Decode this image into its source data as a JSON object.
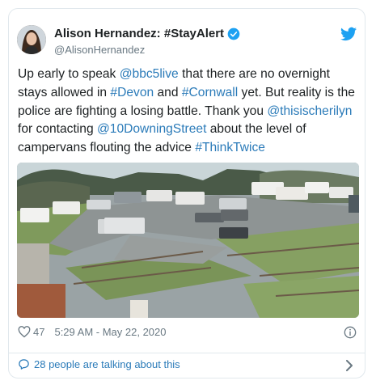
{
  "author": {
    "name": "Alison Hernandez: #StayAlert",
    "handle": "@AlisonHernandez"
  },
  "tweet": {
    "segments": [
      {
        "text": "Up early to speak ",
        "link": false
      },
      {
        "text": "@bbc5live",
        "link": true
      },
      {
        "text": " that there are no overnight stays allowed in ",
        "link": false
      },
      {
        "text": "#Devon",
        "link": true
      },
      {
        "text": " and ",
        "link": false
      },
      {
        "text": "#Cornwall",
        "link": true
      },
      {
        "text": " yet. But reality is the police are fighting a losing battle. Thank you ",
        "link": false
      },
      {
        "text": "@thisischerilyn",
        "link": true
      },
      {
        "text": " for contacting ",
        "link": false
      },
      {
        "text": "@10DowningStreet",
        "link": true
      },
      {
        "text": " about the level of campervans flouting the advice ",
        "link": false
      },
      {
        "text": "#ThinkTwice",
        "link": true
      }
    ]
  },
  "footer": {
    "likes": "47",
    "timestamp": "5:29 AM - May 22, 2020"
  },
  "conversation": {
    "label": "28 people are talking about this"
  },
  "colors": {
    "link": "#2b7bb9",
    "verified": "#1da1f2",
    "muted": "#697882",
    "border": "#e1e8ed"
  },
  "icons": [
    "verified-badge-icon",
    "twitter-bird-icon",
    "heart-icon",
    "info-icon",
    "speech-bubble-icon",
    "chevron-right-icon"
  ]
}
